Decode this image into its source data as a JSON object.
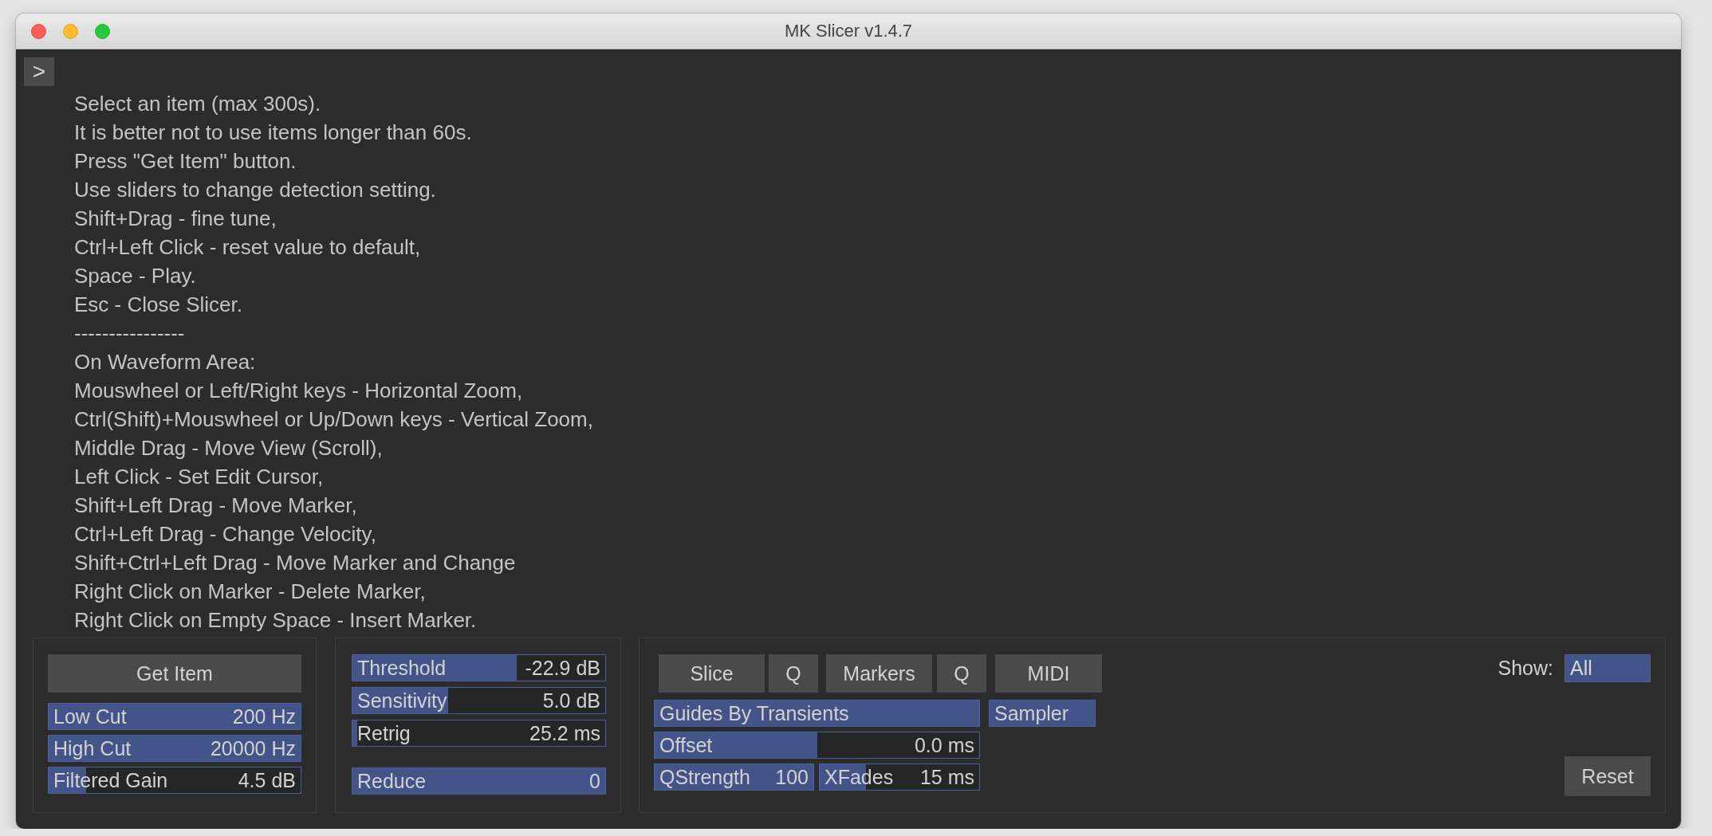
{
  "window": {
    "title": "MK Slicer v1.4.7"
  },
  "toggle": {
    "label": ">"
  },
  "help_lines": [
    "Select an item (max 300s).",
    "It is better not to use items longer than 60s.",
    "Press \"Get Item\" button.",
    "Use sliders to change detection setting.",
    "Shift+Drag - fine tune,",
    "Ctrl+Left Click - reset value to default,",
    "Space - Play.",
    "Esc - Close Slicer.",
    "----------------",
    "On Waveform Area:",
    "Mouswheel or Left/Right keys - Horizontal Zoom,",
    "Ctrl(Shift)+Mouswheel or Up/Down keys - Vertical Zoom,",
    "Middle Drag - Move View (Scroll),",
    "Left Click - Set Edit Cursor,",
    "Shift+Left Drag - Move Marker,",
    "Ctrl+Left Drag - Change Velocity,",
    "Shift+Ctrl+Left Drag - Move Marker and Change",
    "Right Click on Marker - Delete Marker,",
    "Right Click on Empty Space - Insert Marker."
  ],
  "filter_panel": {
    "button": "Get Item",
    "sliders": [
      {
        "label": "Low Cut",
        "value": "200 Hz",
        "level": 1
      },
      {
        "label": "High Cut",
        "value": "20000 Hz",
        "level": 1
      },
      {
        "label": "Filtered Gain",
        "value": "4.5 dB",
        "level": 0.15
      }
    ]
  },
  "detect_panel": {
    "sliders": [
      {
        "label": "Threshold",
        "value": "-22.9 dB",
        "level": 0.65
      },
      {
        "label": "Sensitivity",
        "value": "5.0 dB",
        "level": 0.38
      },
      {
        "label": "Retrig",
        "value": "25.2 ms",
        "level": 0.02
      },
      {
        "label": "Reduce",
        "value": "0",
        "level": 1
      }
    ]
  },
  "main_panel": {
    "buttons": [
      "Slice",
      "Q",
      "Markers",
      "Q",
      "MIDI"
    ],
    "toggles": [
      {
        "label": "Guides By Transients",
        "on": true
      },
      {
        "label": "Sampler",
        "on": true
      }
    ],
    "sliders": [
      {
        "label": "Offset",
        "value": "0.0 ms",
        "level": 0.5
      },
      {
        "label": "QStrength",
        "value": "100",
        "level": 1
      },
      {
        "label": "XFades",
        "value": "15 ms",
        "level": 0.29
      }
    ],
    "show": {
      "label": "Show:",
      "value": "All"
    },
    "reset": "Reset"
  }
}
